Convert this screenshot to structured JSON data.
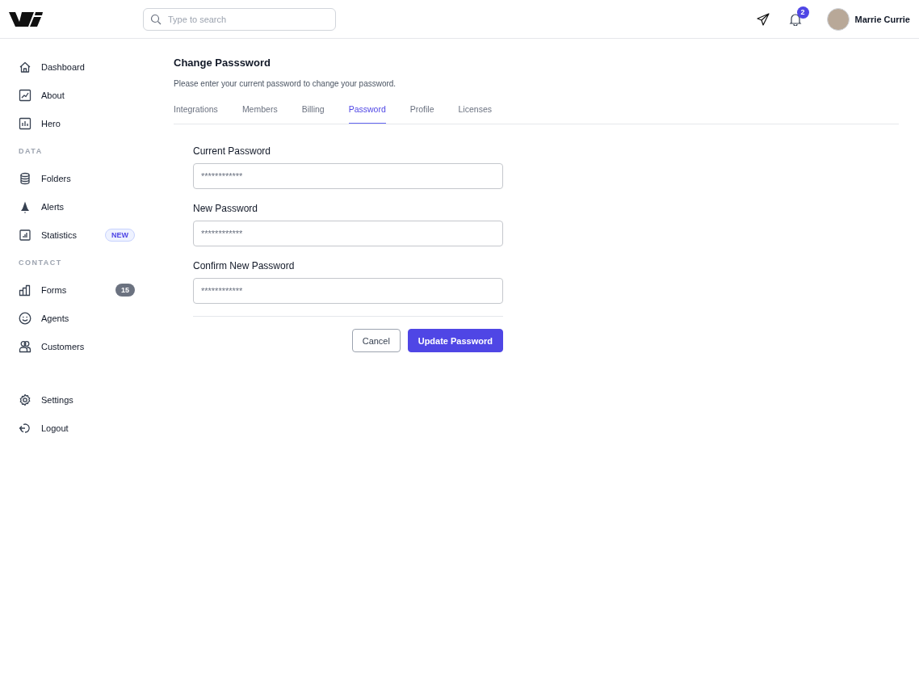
{
  "header": {
    "search": {
      "placeholder": "Type to search"
    },
    "notifications": {
      "count": "2"
    },
    "user": {
      "name": "Marrie Currie"
    }
  },
  "sidebar": {
    "groups": [
      {
        "items": [
          {
            "label": "Dashboard",
            "selected": false
          },
          {
            "label": "About",
            "selected": false
          },
          {
            "label": "Hero",
            "selected": false
          }
        ]
      },
      {
        "heading": "DATA",
        "items": [
          {
            "label": "Folders",
            "selected": false
          },
          {
            "label": "Alerts",
            "selected": false
          },
          {
            "label": "Statistics",
            "selected": false,
            "badge": {
              "kind": "new",
              "text": "NEW"
            }
          }
        ]
      },
      {
        "heading": "CONTACT",
        "items": [
          {
            "label": "Forms",
            "selected": false,
            "badge": {
              "kind": "count",
              "text": "15"
            }
          },
          {
            "label": "Agents",
            "selected": false
          },
          {
            "label": "Customers",
            "selected": false
          }
        ]
      }
    ],
    "footer_items": [
      {
        "label": "Settings"
      },
      {
        "label": "Logout"
      }
    ]
  },
  "page": {
    "title": "Change Passsword",
    "subtitle": "Please enter your current password to change your password.",
    "tabs": [
      {
        "label": "Integrations",
        "selected": false
      },
      {
        "label": "Members",
        "selected": false
      },
      {
        "label": "Billing",
        "selected": false
      },
      {
        "label": "Password",
        "selected": true
      },
      {
        "label": "Profile",
        "selected": false
      },
      {
        "label": "Licenses",
        "selected": false
      }
    ],
    "fields": [
      {
        "label": "Current Password",
        "placeholder": "************"
      },
      {
        "label": "New Password",
        "placeholder": "************"
      },
      {
        "label": "Confirm New Password",
        "placeholder": "************"
      }
    ],
    "buttons": [
      {
        "kind": "secondary",
        "label": "Cancel"
      },
      {
        "kind": "primary",
        "label": "Update Password"
      }
    ]
  }
}
